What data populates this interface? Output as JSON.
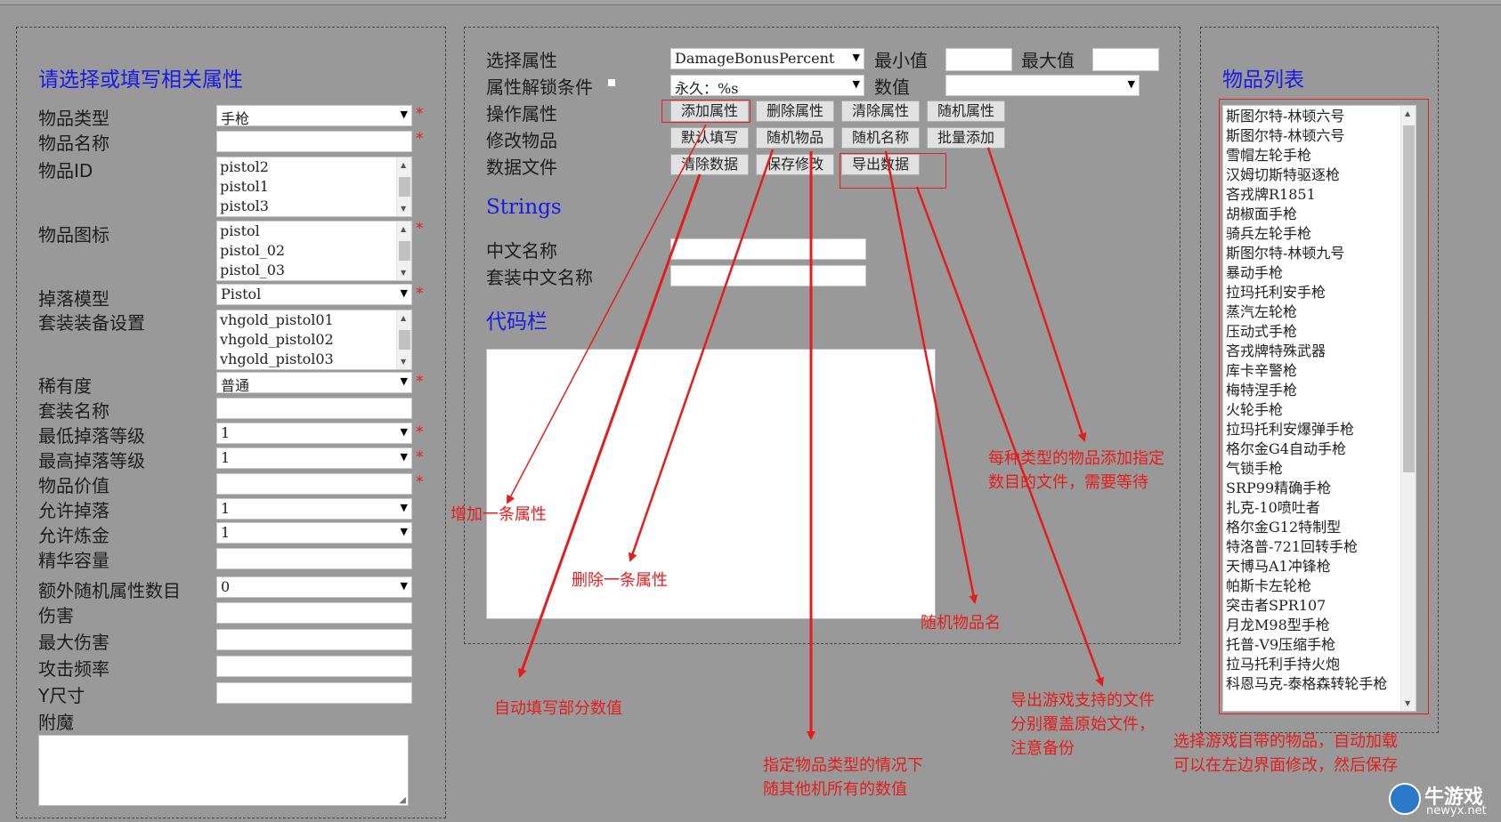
{
  "left": {
    "heading": "请选择或填写相关属性",
    "labels": [
      "物品类型",
      "物品名称",
      "物品ID",
      "物品图标",
      "掉落模型",
      "套装装备设置",
      "稀有度",
      "套装名称",
      "最低掉落等级",
      "最高掉落等级",
      "物品价值",
      "允许掉落",
      "允许炼金",
      "精华容量",
      "额外随机属性数目",
      "伤害",
      "最大伤害",
      "攻击频率",
      "Y尺寸",
      "附魔"
    ],
    "item_type": "手枪",
    "item_name": "",
    "item_id_list": [
      "pistol2",
      "pistol1",
      "pistol3"
    ],
    "item_icon_list": [
      "pistol",
      "pistol_02",
      "pistol_03"
    ],
    "drop_model": "Pistol",
    "set_list": [
      "vhgold_pistol01",
      "vhgold_pistol02",
      "vhgold_pistol03"
    ],
    "rarity": "普通",
    "set_name": "",
    "min_drop_level": "1",
    "max_drop_level": "1",
    "item_value": "",
    "allow_drop": "1",
    "allow_alchemy": "1",
    "essence_capacity": "",
    "extra_random_attr_count": "0",
    "damage": "",
    "max_damage": "",
    "attack_rate": "",
    "y_size": "",
    "required_mark": "*"
  },
  "middle": {
    "select_attr_label": "选择属性",
    "select_attr_value": "DamageBonusPercent",
    "min_label": "最小值",
    "max_label": "最大值",
    "min_value": "",
    "max_value": "",
    "unlock_label": "属性解锁条件",
    "unlock_value": "永久：%s",
    "value_label": "数值",
    "value_value": "",
    "operate_label": "操作属性",
    "modify_label": "修改物品",
    "datafile_label": "数据文件",
    "buttons": {
      "add_attr": "添加属性",
      "delete_attr": "删除属性",
      "clear_attr": "清除属性",
      "random_attr": "随机属性",
      "default_fill": "默认填写",
      "random_item": "随机物品",
      "random_name": "随机名称",
      "batch_add": "批量添加",
      "clear_data": "清除数据",
      "save_changes": "保存修改",
      "export_data": "导出数据"
    },
    "strings_heading": "Strings",
    "cn_name_label": "中文名称",
    "set_cn_name_label": "套装中文名称",
    "cn_name_value": "",
    "set_cn_name_value": "",
    "code_heading": "代码栏"
  },
  "right": {
    "heading": "物品列表",
    "items": [
      "斯图尔特-林顿六号",
      "斯图尔特-林顿六号",
      "雪帽左轮手枪",
      "汉姆切斯特驱逐枪",
      "吝戎牌R1851",
      "胡椒面手枪",
      "骑兵左轮手枪",
      "斯图尔特-林顿九号",
      "暴动手枪",
      "拉玛托利安手枪",
      "蒸汽左轮枪",
      "压动式手枪",
      "吝戎牌特殊武器",
      "库卡辛警枪",
      "梅特涅手枪",
      "火轮手枪",
      "拉玛托利安爆弹手枪",
      "格尔金G4自动手枪",
      "气锁手枪",
      "SRP99精确手枪",
      "扎克-10喷吐者",
      "格尔金G12特制型",
      "特洛普-721回转手枪",
      "天博马A1冲锋枪",
      "帕斯卡左轮枪",
      "突击者SPR107",
      "月龙M98型手枪",
      "托普-V9压缩手枪",
      "拉马托利手持火炮",
      "科恩马克-泰格森转轮手枪"
    ]
  },
  "annotations": {
    "add_one_attr": "增加一条属性",
    "delete_one_attr": "删除一条属性",
    "auto_fill": "自动填写部分数值",
    "random_others_1": "指定物品类型的情况下",
    "random_others_2": "随其他机所有的数值",
    "random_item_name": "随机物品名",
    "batch_1": "每种类型的物品添加指定",
    "batch_2": "数目的文件，需要等待",
    "export_1": "导出游戏支持的文件",
    "export_2": "分别覆盖原始文件，",
    "export_3": "注意备份",
    "select_1": "选择游戏自带的物品，自动加载",
    "select_2": "可以在左边界面修改，然后保存"
  },
  "watermark": {
    "name": "牛游戏",
    "url": "newyx.net"
  },
  "colors": {
    "background": "#999999",
    "heading": "#1a1ae6",
    "annotation": "#e61c1c"
  }
}
